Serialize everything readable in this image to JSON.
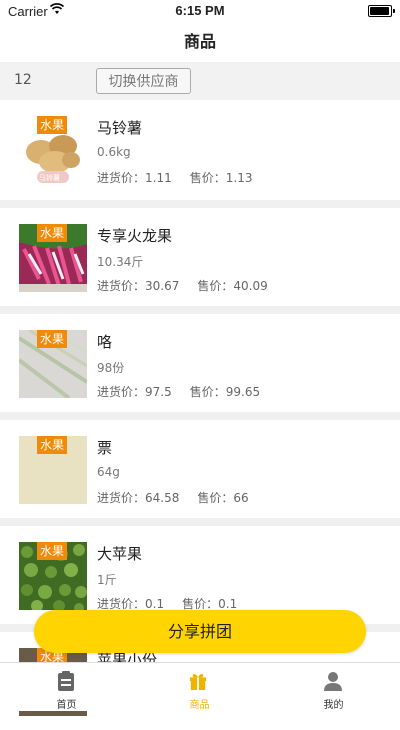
{
  "status_bar": {
    "carrier": "Carrier",
    "time": "6:15 PM"
  },
  "nav": {
    "title": "商品"
  },
  "toolbar": {
    "count": "12",
    "switch_label": "切换供应商"
  },
  "labels": {
    "cost": "进货价：",
    "sell": "售价："
  },
  "items": [
    {
      "name": "马铃薯",
      "spec": "0.6kg",
      "cost": "1.11",
      "sell": "1.13",
      "tag": "水果",
      "thumb_caption": "马铃薯",
      "thumb": "potato-image"
    },
    {
      "name": "专享火龙果",
      "spec": "10.34斤",
      "cost": "30.67",
      "sell": "40.09",
      "tag": "水果",
      "thumb": "dragon-fruit-image"
    },
    {
      "name": "咯",
      "spec": "98份",
      "cost": "97.5",
      "sell": "99.65",
      "tag": "水果",
      "thumb": "sticks-image"
    },
    {
      "name": "票",
      "spec": "64g",
      "cost": "64.58",
      "sell": "66",
      "tag": "水果",
      "thumb": "beige-image"
    },
    {
      "name": "大苹果",
      "spec": "1斤",
      "cost": "0.1",
      "sell": "0.1",
      "tag": "水果",
      "thumb": "green-leaves-image"
    },
    {
      "name": "苹果小份",
      "tag": "水果",
      "thumb": "partial-image"
    }
  ],
  "share_button": {
    "label": "分享拼团"
  },
  "tabbar": {
    "tabs": [
      {
        "label": "首页",
        "icon": "clipboard-icon"
      },
      {
        "label": "商品",
        "icon": "gift-icon",
        "active": true
      },
      {
        "label": "我的",
        "icon": "person-icon"
      }
    ],
    "accent": "#f0b400"
  },
  "colors": {
    "tag": "#f08a0a",
    "share_button": "#ffd400"
  }
}
